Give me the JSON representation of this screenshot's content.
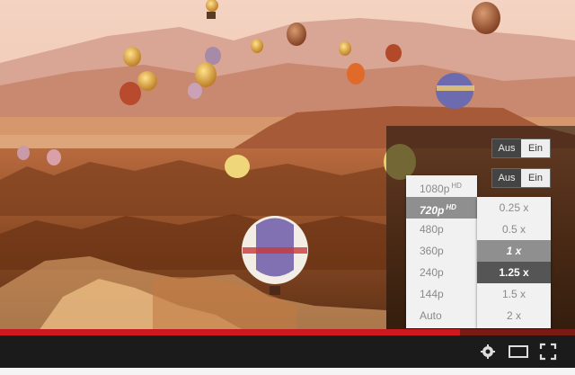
{
  "settings": {
    "annotations_toggle": {
      "off_label": "Aus",
      "on_label": "Ein",
      "state": "on"
    },
    "captions_toggle": {
      "off_label": "Aus",
      "on_label": "Ein",
      "state": "on"
    }
  },
  "quality_menu": {
    "items": [
      {
        "label": "1080p",
        "badge": "HD"
      },
      {
        "label": "720p",
        "badge": "HD",
        "selected": true
      },
      {
        "label": "480p",
        "badge": ""
      },
      {
        "label": "360p",
        "badge": ""
      },
      {
        "label": "240p",
        "badge": ""
      },
      {
        "label": "144p",
        "badge": ""
      },
      {
        "label": "Auto",
        "badge": ""
      }
    ]
  },
  "speed_menu": {
    "items": [
      {
        "label": "0.25 x"
      },
      {
        "label": "0.5 x"
      },
      {
        "label": "1 x",
        "current": true
      },
      {
        "label": "1.25 x",
        "hover": true
      },
      {
        "label": "1.5 x"
      },
      {
        "label": "2 x"
      }
    ]
  },
  "player": {
    "progress_fraction": 0.8,
    "colors": {
      "progress": "#cc181e",
      "controls_bg": "#1b1b1b"
    }
  },
  "icons": [
    "settings-icon",
    "theater-mode-icon",
    "fullscreen-icon"
  ]
}
